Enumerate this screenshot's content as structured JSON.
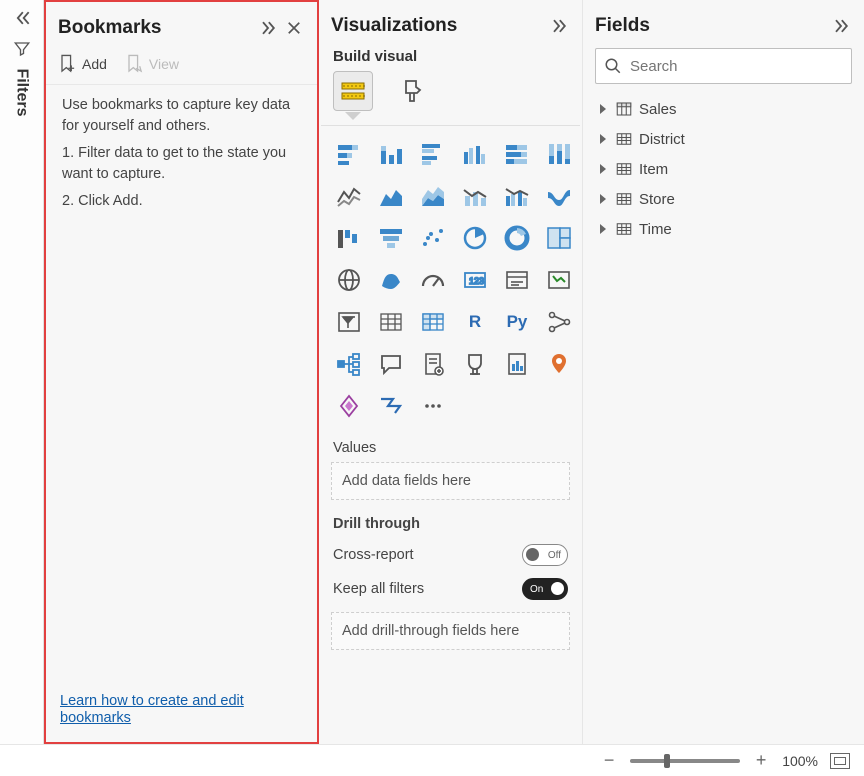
{
  "filters": {
    "label": "Filters"
  },
  "bookmarks": {
    "title": "Bookmarks",
    "add_label": "Add",
    "view_label": "View",
    "help_intro": "Use bookmarks to capture key data for yourself and others.",
    "help_step1": "1. Filter data to get to the state you want to capture.",
    "help_step2": "2. Click Add.",
    "learn_link": "Learn how to create and edit bookmarks"
  },
  "visualizations": {
    "title": "Visualizations",
    "subtitle": "Build visual",
    "values_label": "Values",
    "values_placeholder": "Add data fields here",
    "drill_label": "Drill through",
    "cross_report_label": "Cross-report",
    "cross_report_state": "Off",
    "keep_filters_label": "Keep all filters",
    "keep_filters_state": "On",
    "drill_placeholder": "Add drill-through fields here",
    "icons": [
      "stacked-bar",
      "stacked-column",
      "clustered-bar",
      "clustered-column",
      "stacked-bar-100",
      "stacked-column-100",
      "line",
      "area",
      "stacked-area",
      "line-stacked-column",
      "line-clustered-column",
      "ribbon",
      "waterfall",
      "funnel",
      "scatter",
      "pie",
      "donut",
      "treemap",
      "map",
      "filled-map",
      "gauge",
      "card",
      "multi-row-card",
      "kpi",
      "slicer",
      "table",
      "matrix",
      "r-visual",
      "py-visual",
      "key-influencers",
      "decomposition-tree",
      "qa",
      "narrative",
      "goals",
      "paginated",
      "arcgis",
      "powerapps",
      "powerautomate",
      "more"
    ]
  },
  "fields": {
    "title": "Fields",
    "search_placeholder": "Search",
    "tables": [
      {
        "name": "Sales",
        "icon": "sum"
      },
      {
        "name": "District",
        "icon": "table"
      },
      {
        "name": "Item",
        "icon": "table"
      },
      {
        "name": "Store",
        "icon": "table"
      },
      {
        "name": "Time",
        "icon": "table"
      }
    ]
  },
  "zoom": {
    "level": "100%"
  }
}
